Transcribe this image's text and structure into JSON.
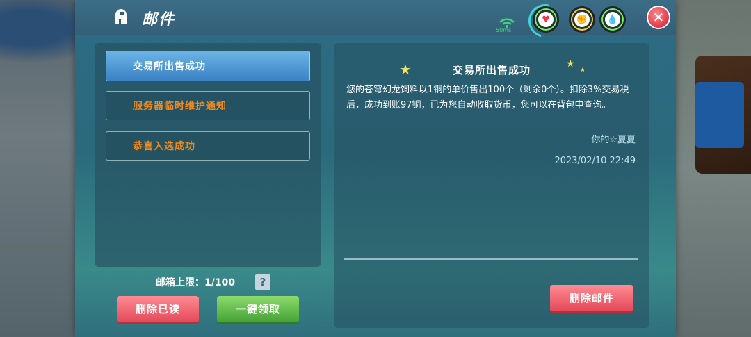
{
  "header": {
    "title": "邮件",
    "ping": "50ms"
  },
  "status_gauges": [
    {
      "name": "health",
      "icon": "heart-icon",
      "glyph": "♥"
    },
    {
      "name": "hunger",
      "icon": "strength-icon",
      "glyph": "✊"
    },
    {
      "name": "water",
      "icon": "water-drop-icon",
      "glyph": "💧"
    }
  ],
  "mail_list": {
    "items": [
      {
        "label": "交易所出售成功",
        "state": "selected"
      },
      {
        "label": "服务器临时维护通知",
        "state": "unread"
      },
      {
        "label": "恭喜入选成功",
        "state": "unread"
      }
    ]
  },
  "footer": {
    "capacity_label": "邮箱上限：1/100",
    "help_glyph": "?",
    "delete_read_label": "删除已读",
    "claim_all_label": "一键领取"
  },
  "detail": {
    "title": "交易所出售成功",
    "body": "您的苍穹幻龙饲料以1铜的单价售出100个（剩余0个）。扣除3%交易税后，成功到账97铜，已为您自动收取货币，您可以在背包中查询。",
    "signature": "你的☆夏夏",
    "date": "2023/02/10 22:49",
    "delete_label": "删除邮件"
  },
  "colors": {
    "accent_blue": "#3a82c4",
    "unread_orange": "#f08a1c",
    "button_red": "#e44a5b",
    "button_green": "#46a338"
  }
}
